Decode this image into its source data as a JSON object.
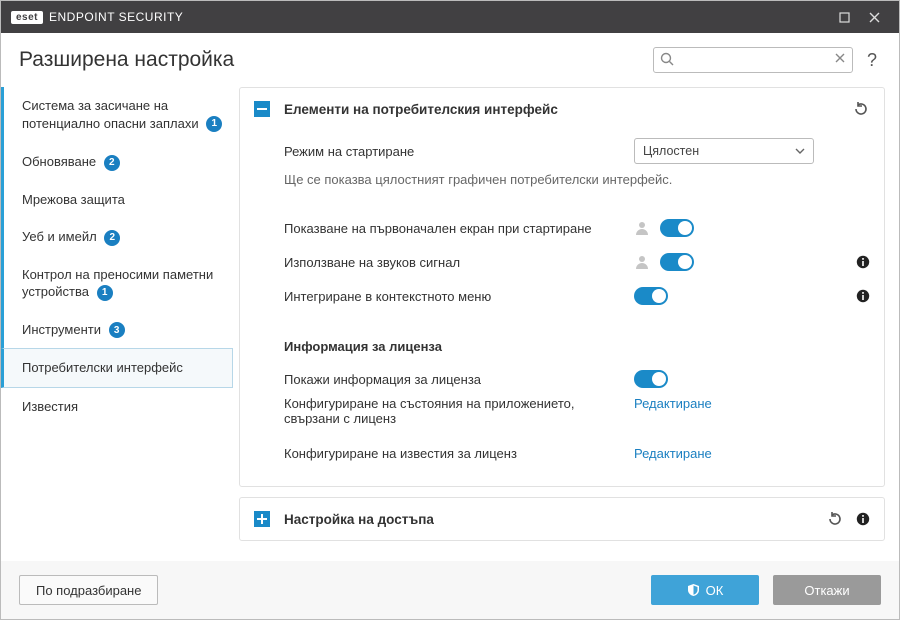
{
  "brand": {
    "badge": "eset",
    "name": "ENDPOINT SECURITY"
  },
  "header": {
    "title": "Разширена настройка",
    "search_placeholder": ""
  },
  "sidebar": {
    "items": [
      {
        "label": "Система за засичане на потенциално опасни заплахи",
        "badge": "1"
      },
      {
        "label": "Обновяване",
        "badge": "2"
      },
      {
        "label": "Мрежова защита",
        "badge": ""
      },
      {
        "label": "Уеб и имейл",
        "badge": "2"
      },
      {
        "label": "Контрол на преносими паметни устройства",
        "badge": "1"
      },
      {
        "label": "Инструменти",
        "badge": "3"
      },
      {
        "label": "Потребителски интерфейс",
        "badge": ""
      },
      {
        "label": "Известия",
        "badge": ""
      }
    ]
  },
  "panel1": {
    "title": "Елементи на потребителския интерфейс",
    "startup_mode_label": "Режим на стартиране",
    "startup_mode_value": "Цялостен",
    "startup_mode_desc": "Ще се показва цялостният графичен потребителски интерфейс.",
    "row_splash": "Показване на първоначален екран при стартиране",
    "row_sound": "Използване на звуков сигнал",
    "row_context": "Интегриране в контекстното меню",
    "license_section": "Информация за лиценза",
    "row_showlic": "Покажи информация за лиценза",
    "row_state_cfg": "Конфигуриране на състояния на приложението, свързани с лиценз",
    "row_notif_cfg": "Конфигуриране на известия за лиценз",
    "edit_label": "Редактиране"
  },
  "panel2": {
    "title": "Настройка на достъпа"
  },
  "footer": {
    "default": "По подразбиране",
    "ok": "ОК",
    "cancel": "Откажи"
  }
}
